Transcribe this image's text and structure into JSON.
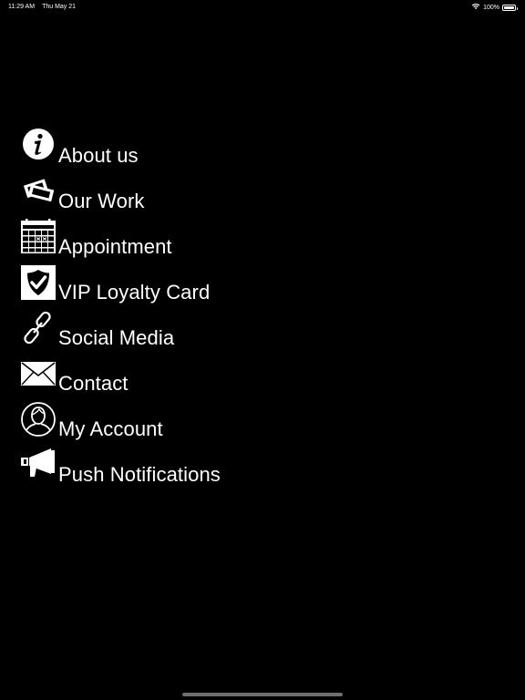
{
  "status_bar": {
    "time": "11:29 AM",
    "date": "Thu May 21",
    "battery_percent": "100%",
    "icons": [
      "wifi-icon",
      "battery-icon"
    ]
  },
  "menu": {
    "items": [
      {
        "label": "About us",
        "icon": "info-icon"
      },
      {
        "label": "Our Work",
        "icon": "photos-icon"
      },
      {
        "label": "Appointment",
        "icon": "calendar-icon"
      },
      {
        "label": "VIP Loyalty Card",
        "icon": "shield-check-icon"
      },
      {
        "label": "Social Media",
        "icon": "link-icon"
      },
      {
        "label": "Contact",
        "icon": "envelope-icon"
      },
      {
        "label": "My Account",
        "icon": "user-icon"
      },
      {
        "label": "Push Notifications",
        "icon": "megaphone-icon"
      }
    ]
  },
  "colors": {
    "background": "#000000",
    "foreground": "#ffffff",
    "home_indicator": "#6e6e6e"
  }
}
